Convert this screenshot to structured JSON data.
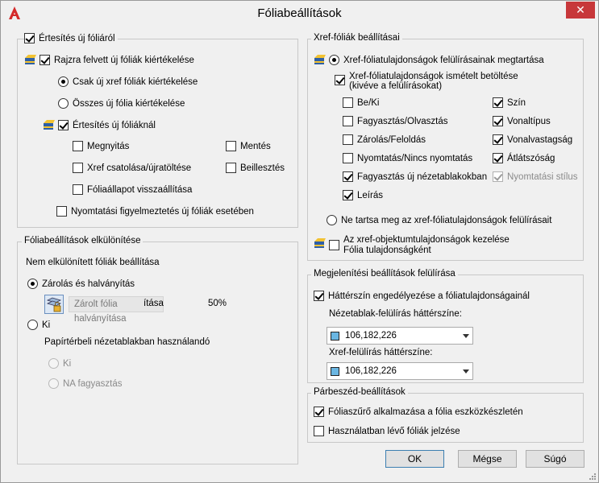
{
  "window": {
    "title": "Fóliabeállítások"
  },
  "notify": {
    "legend": "Értesítés új fóliáról",
    "evaluate_drawing": "Rajzra felvett új fóliák kiértékelése",
    "only_xref": "Csak új xref fóliák kiértékelése",
    "all_new": "Összes új fólia kiértékelése",
    "notify_new": "Értesítés új fóliáknál",
    "open": "Megnyitás",
    "save": "Mentés",
    "xref_attach": "Xref csatolása/újratöltése",
    "insert": "Beillesztés",
    "restore_state": "Fóliaállapot visszaállítása",
    "plot_warning": "Nyomtatási figyelmeztetés új fóliák esetében"
  },
  "isolation": {
    "legend": "Fóliabeállítások elkülönítése",
    "subtitle": "Nem elkülönített fóliák beállítása",
    "lock_fade": "Zárolás és halványítás",
    "fade_box": "Zárolt fólia halványítása",
    "fade_suffix": "ítása",
    "fade_value": "50%",
    "off": "Ki",
    "paper_label": "Papírtérbeli nézetablakban használandó",
    "paper_off": "Ki",
    "paper_freeze": "NA fagyasztás"
  },
  "xref": {
    "legend": "Xref-fóliák beállításai",
    "keep_overrides": "Xref-fóliatulajdonságok felülírásainak megtartása",
    "reload_line1": "Xref-fóliatulajdonságok ismételt betöltése",
    "reload_line2": "(kivéve a felülírásokat)",
    "on_off": "Be/Ki",
    "color": "Szín",
    "freeze_thaw": "Fagyasztás/Olvasztás",
    "linetype": "Vonaltípus",
    "lock_unlock": "Zárolás/Feloldás",
    "lineweight": "Vonalvastagság",
    "plot_noplot": "Nyomtatás/Nincs nyomtatás",
    "transparency": "Átlátszóság",
    "vp_freeze": "Fagyasztás új nézetablakokban",
    "plot_style": "Nyomtatási stílus",
    "description": "Leírás",
    "no_keep": "Ne tartsa meg az xref-fóliatulajdonságok felülírásait",
    "obj_line1": "Az xref-objektumtulajdonságok kezelése",
    "obj_line2": "Fólia tulajdonságként"
  },
  "display": {
    "legend": "Megjelenítési beállítások felülírása",
    "bg_enable": "Háttérszín engedélyezése a fóliatulajdonságainál",
    "vp_label": "Nézetablak-felülírás háttérszíne:",
    "vp_value": "106,182,226",
    "xref_label": "Xref-felülírás háttérszíne:",
    "xref_value": "106,182,226",
    "swatch_color": "#6ab6e2"
  },
  "dialog": {
    "legend": "Párbeszéd-beállítások",
    "apply_filter": "Fóliaszűrő alkalmazása a fólia eszközkészletén",
    "indicate_used": "Használatban lévő fóliák jelzése"
  },
  "buttons": {
    "ok": "OK",
    "cancel": "Mégse",
    "help": "Súgó"
  }
}
